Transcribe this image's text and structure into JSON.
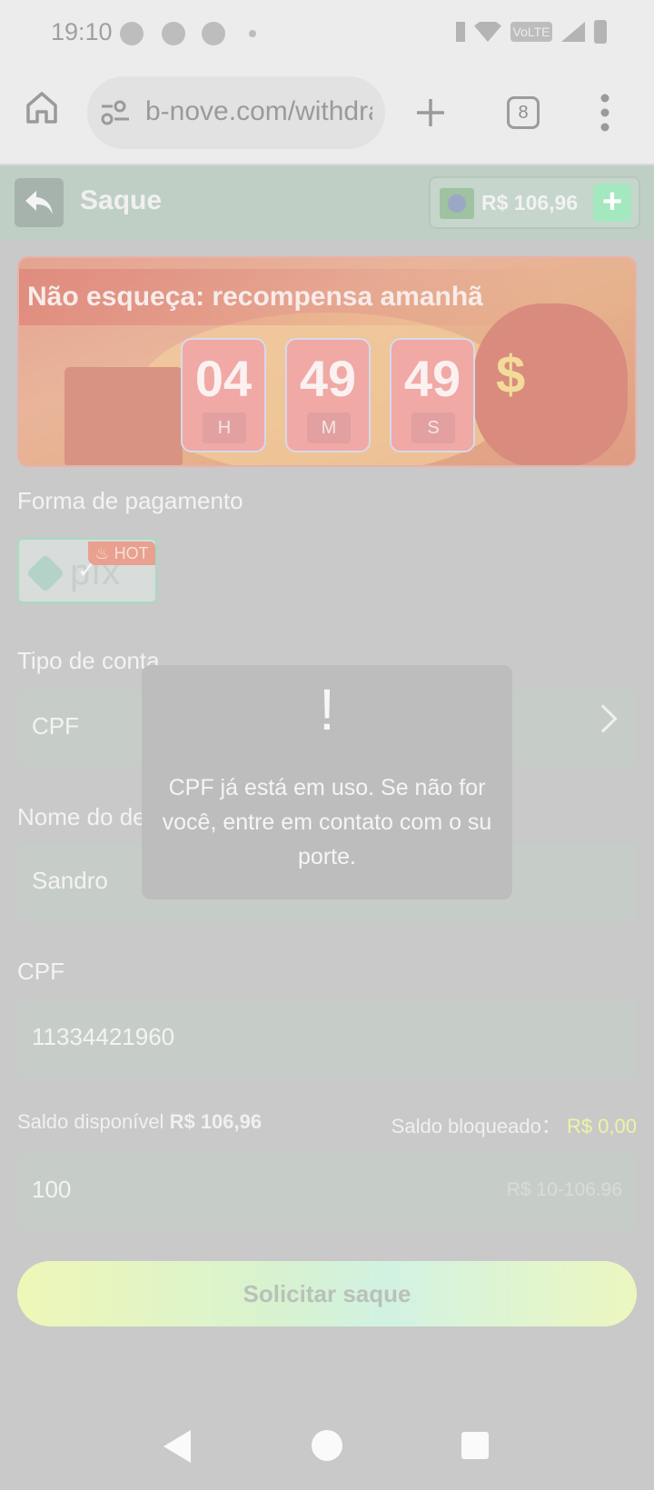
{
  "status_bar": {
    "time": "19:10",
    "network": "VoLTE"
  },
  "browser": {
    "url": "b-nove.com/withdraw",
    "tab_count": "8"
  },
  "header": {
    "title": "Saque",
    "balance": "R$ 106,96"
  },
  "banner": {
    "title": "Não esqueça: recompensa amanhã",
    "countdown": [
      {
        "value": "04",
        "unit": "H"
      },
      {
        "value": "49",
        "unit": "M"
      },
      {
        "value": "49",
        "unit": "S"
      }
    ],
    "symbol": "$"
  },
  "form": {
    "payment_label": "Forma de pagamento",
    "payment_method": {
      "name": "pix",
      "badge": "HOT"
    },
    "account_type_label": "Tipo de conta",
    "account_type_value": "CPF",
    "recipient_label": "Nome do destinatário",
    "recipient_value": "Sandro",
    "cpf_label": "CPF",
    "cpf_value": "11334421960",
    "available_label": "Saldo disponível",
    "available_value": "R$ 106,96",
    "blocked_label": "Saldo bloqueado：",
    "blocked_value": "R$ 0,00",
    "amount_value": "100",
    "amount_range": "R$ 10-106.96",
    "submit_label": "Solicitar saque"
  },
  "toast": {
    "icon": "!",
    "message": "CPF já está em uso. Se não for você, entre em contato com o suporte."
  }
}
